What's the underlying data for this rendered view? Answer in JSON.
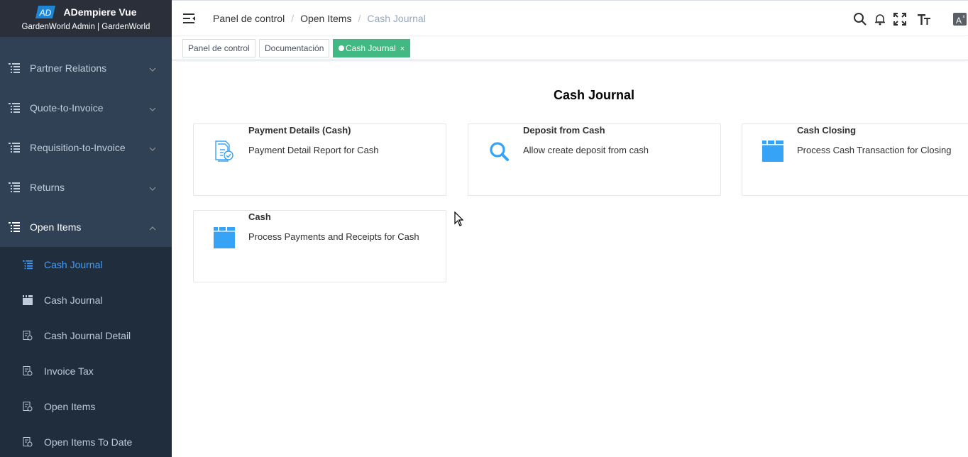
{
  "brand": {
    "logo_text": "AD",
    "title": "ADempiere Vue",
    "subtitle": "GardenWorld Admin | GardenWorld"
  },
  "sidebar": {
    "items": [
      {
        "label": "Partner Relations",
        "icon": "tree-icon",
        "expanded": false
      },
      {
        "label": "Quote-to-Invoice",
        "icon": "tree-icon",
        "expanded": false
      },
      {
        "label": "Requisition-to-Invoice",
        "icon": "tree-icon",
        "expanded": false
      },
      {
        "label": "Returns",
        "icon": "tree-icon",
        "expanded": false
      },
      {
        "label": "Open Items",
        "icon": "tree-icon",
        "expanded": true
      }
    ],
    "subitems": [
      {
        "label": "Cash Journal",
        "icon": "tree-icon",
        "active": true
      },
      {
        "label": "Cash Journal",
        "icon": "window-icon",
        "active": false
      },
      {
        "label": "Cash Journal Detail",
        "icon": "report-icon",
        "active": false
      },
      {
        "label": "Invoice Tax",
        "icon": "report-icon",
        "active": false
      },
      {
        "label": "Open Items",
        "icon": "report-icon",
        "active": false
      },
      {
        "label": "Open Items To Date",
        "icon": "report-icon",
        "active": false
      }
    ]
  },
  "navbar": {
    "breadcrumb": [
      "Panel de control",
      "Open Items",
      "Cash Journal"
    ],
    "separator": "/",
    "icons": [
      "search-icon",
      "bell-icon",
      "fullscreen-icon",
      "font-size-icon",
      "language-icon"
    ]
  },
  "tags": [
    {
      "label": "Panel de control",
      "active": false
    },
    {
      "label": "Documentación",
      "active": false
    },
    {
      "label": "Cash Journal",
      "active": true,
      "close": "×"
    }
  ],
  "main": {
    "title": "Cash Journal",
    "cards": [
      {
        "title": "Payment Details (Cash)",
        "description": "Payment Detail Report for Cash",
        "icon": "report-icon"
      },
      {
        "title": "Deposit from Cash",
        "description": "Allow create deposit from cash",
        "icon": "search-icon"
      },
      {
        "title": "Cash Closing",
        "description": "Process Cash Transaction for Closing",
        "icon": "window-icon"
      },
      {
        "title": "Cash",
        "description": "Process Payments and Receipts for Cash",
        "icon": "window-icon"
      }
    ]
  },
  "colors": {
    "sidebar_bg": "#304156",
    "submenu_bg": "#1f2d3d",
    "active_blue": "#409eff",
    "tag_green": "#42b983",
    "icon_blue": "#36a3f7"
  }
}
